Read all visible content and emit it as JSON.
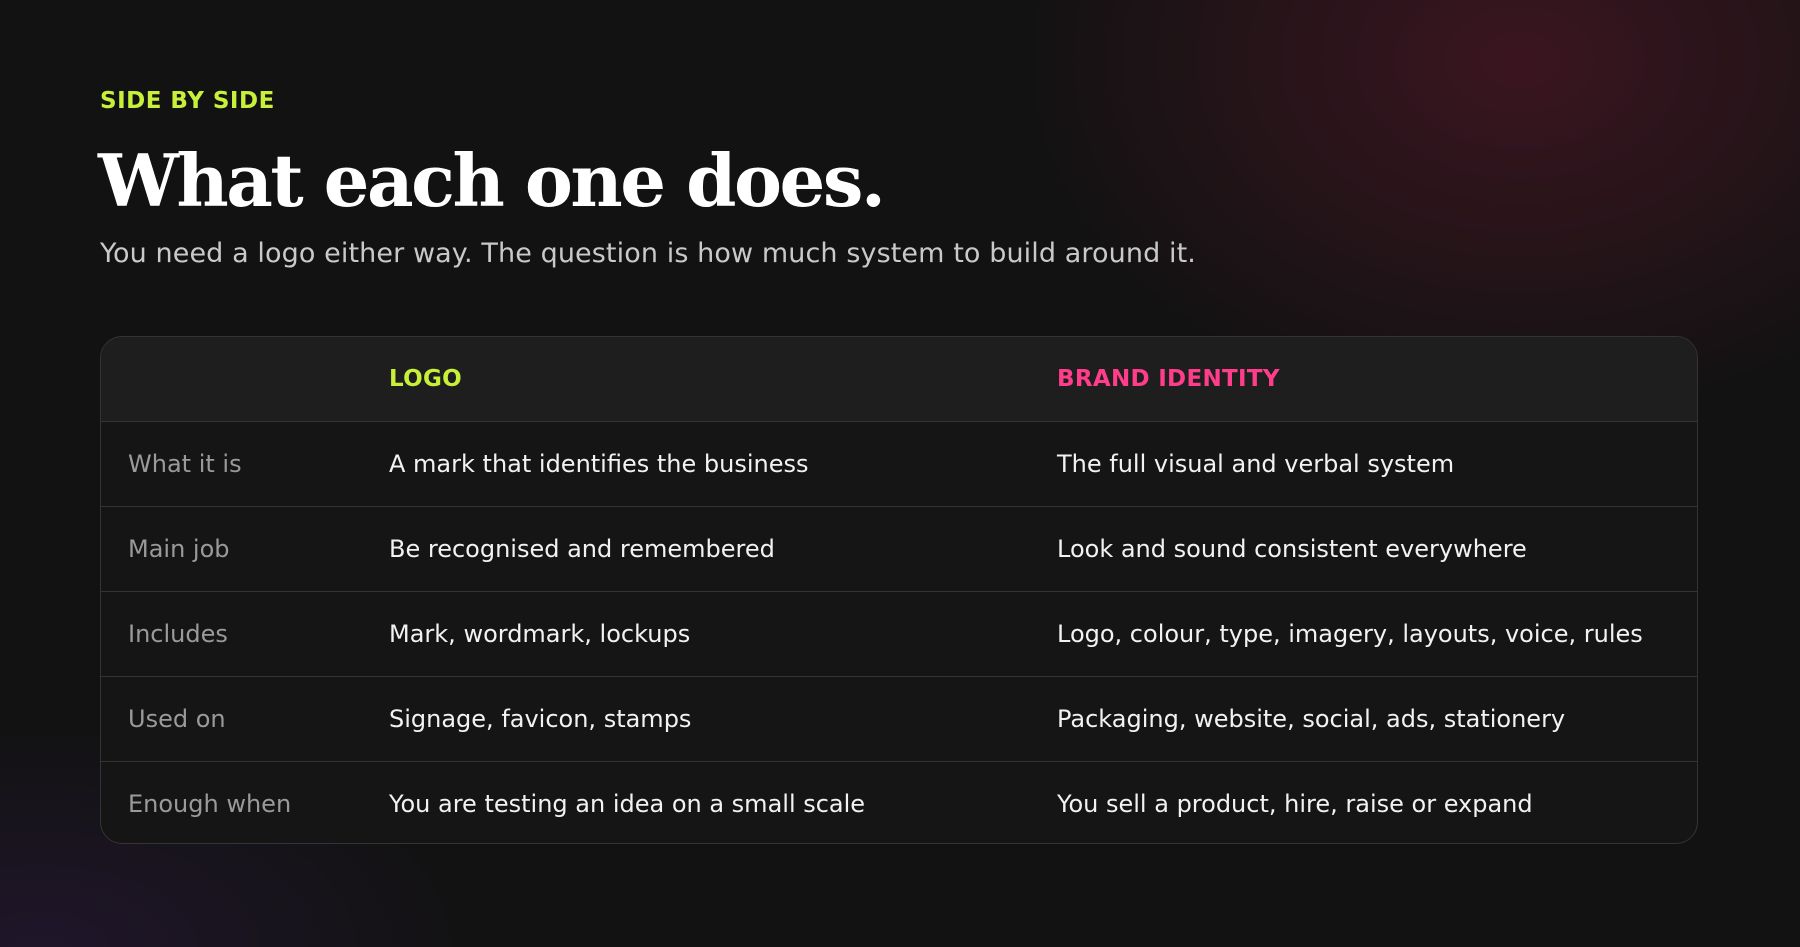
{
  "section": {
    "eyebrow": "SIDE BY SIDE",
    "title": "What each one does.",
    "subtitle": "You need a logo either way. The question is how much system to build around it."
  },
  "table": {
    "columns": [
      "",
      "LOGO",
      "BRAND IDENTITY"
    ],
    "rows": [
      {
        "label": "What it is",
        "logo": "A mark that identifies the business",
        "brand": "The full visual and verbal system"
      },
      {
        "label": "Main job",
        "logo": "Be recognised and remembered",
        "brand": "Look and sound consistent everywhere"
      },
      {
        "label": "Includes",
        "logo": "Mark, wordmark, lockups",
        "brand": "Logo, colour, type, imagery, layouts, voice, rules"
      },
      {
        "label": "Used on",
        "logo": "Signage, favicon, stamps",
        "brand": "Packaging, website, social, ads, stationery"
      },
      {
        "label": "Enough when",
        "logo": "You are testing an idea on a small scale",
        "brand": "You sell a product, hire, raise or expand"
      }
    ]
  },
  "colors": {
    "accent_logo": "#c8f03a",
    "accent_brand": "#ff3d8b",
    "background": "#121212"
  }
}
